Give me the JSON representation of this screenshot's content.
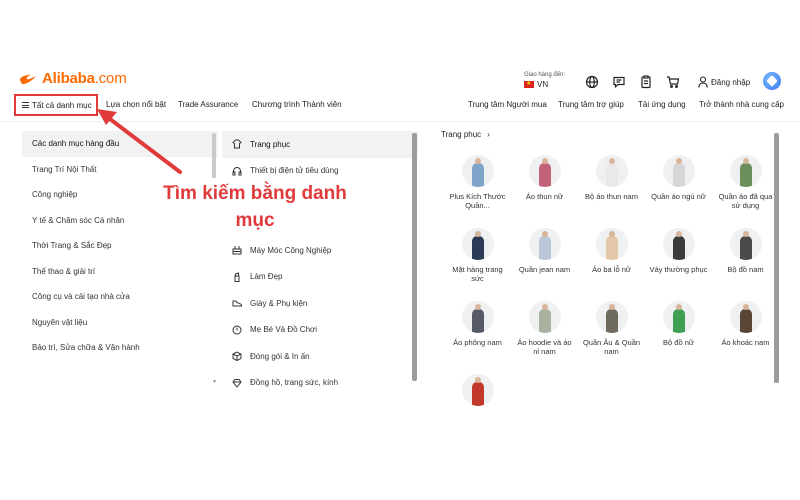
{
  "header": {
    "logo_text": "Alibaba",
    "logo_suffix": ".com",
    "ship_label": "Giao hàng đến:",
    "ship_country": "VN",
    "login_label": "Đăng nhập",
    "icons": [
      "globe-icon",
      "message-icon",
      "orders-icon",
      "cart-icon",
      "user-icon",
      "ai-assistant-icon"
    ]
  },
  "nav": {
    "all_categories": "Tất cả danh mục",
    "featured": "Lựa chọn nổi bật",
    "trade_assurance": "Trade Assurance",
    "membership": "Chương trình Thành viên",
    "buyer_center": "Trung tâm Người mua",
    "help_center": "Trung tâm trợ giúp",
    "app": "Tải ứng dụng",
    "supplier": "Trở thành nhà cung cấp"
  },
  "left_menu": {
    "items": [
      "Các danh mục hàng đầu",
      "Trang Trí Nội Thất",
      "Công nghiệp",
      "Y tế & Chăm sóc Cá nhân",
      "Thời Trang & Sắc Đẹp",
      "Thể thao & giải trí",
      "Công cụ và cải tạo nhà cửa",
      "Nguyên vật liệu",
      "Bảo trì, Sửa chữa & Vận hành"
    ]
  },
  "mid_menu": {
    "items": [
      {
        "label": "Trang phục",
        "icon": "hanger-icon"
      },
      {
        "label": "Thiết bị điện tử tiêu dùng",
        "icon": "headphones-icon"
      },
      {
        "label": "",
        "icon": ""
      },
      {
        "label": "",
        "icon": ""
      },
      {
        "label": "Máy Móc Công Nghiệp",
        "icon": "machine-icon"
      },
      {
        "label": "Làm Đẹp",
        "icon": "beauty-icon"
      },
      {
        "label": "Giày & Phụ kiện",
        "icon": "shoe-icon"
      },
      {
        "label": "Mẹ Bé Và Đồ Chơi",
        "icon": "baby-icon"
      },
      {
        "label": "Đóng gói & In ấn",
        "icon": "package-icon"
      },
      {
        "label": "Đồng hồ, trang sức, kính",
        "icon": "jewelry-icon"
      }
    ]
  },
  "annotation": {
    "text": "Tìm kiếm bằng danh mục",
    "color": "#e03a3a"
  },
  "subcategory": {
    "title": "Trang phục",
    "items": [
      {
        "label": "Plus Kích Thước Quần...",
        "color": "#7fa3c9"
      },
      {
        "label": "Áo thun nữ",
        "color": "#c2637a"
      },
      {
        "label": "Bộ áo thun nam",
        "color": "#e9e9e9"
      },
      {
        "label": "Quần áo ngủ nữ",
        "color": "#d6d6d6"
      },
      {
        "label": "Quần áo đã qua sử dụng",
        "color": "#6b8f5a"
      },
      {
        "label": "Mặt hàng trang sức",
        "color": "#2d3a55"
      },
      {
        "label": "Quần jean nam",
        "color": "#b9c7d6"
      },
      {
        "label": "Áo ba lỗ nữ",
        "color": "#e4c7a8"
      },
      {
        "label": "Váy thường phục",
        "color": "#3b3b3b"
      },
      {
        "label": "Bộ đồ nam",
        "color": "#4a4a4a"
      },
      {
        "label": "Áo phông nam",
        "color": "#555a66"
      },
      {
        "label": "Áo hoodie và áo nỉ nam",
        "color": "#a9b2a0"
      },
      {
        "label": "Quần Âu & Quần nam",
        "color": "#6e6a5c"
      },
      {
        "label": "Bộ đồ nữ",
        "color": "#3fa052"
      },
      {
        "label": "Áo khoác nam",
        "color": "#5b4636"
      },
      {
        "label": "",
        "color": "#c0392b"
      }
    ]
  },
  "colors": {
    "brand": "#ff6a00",
    "highlight": "#e03a3a"
  }
}
